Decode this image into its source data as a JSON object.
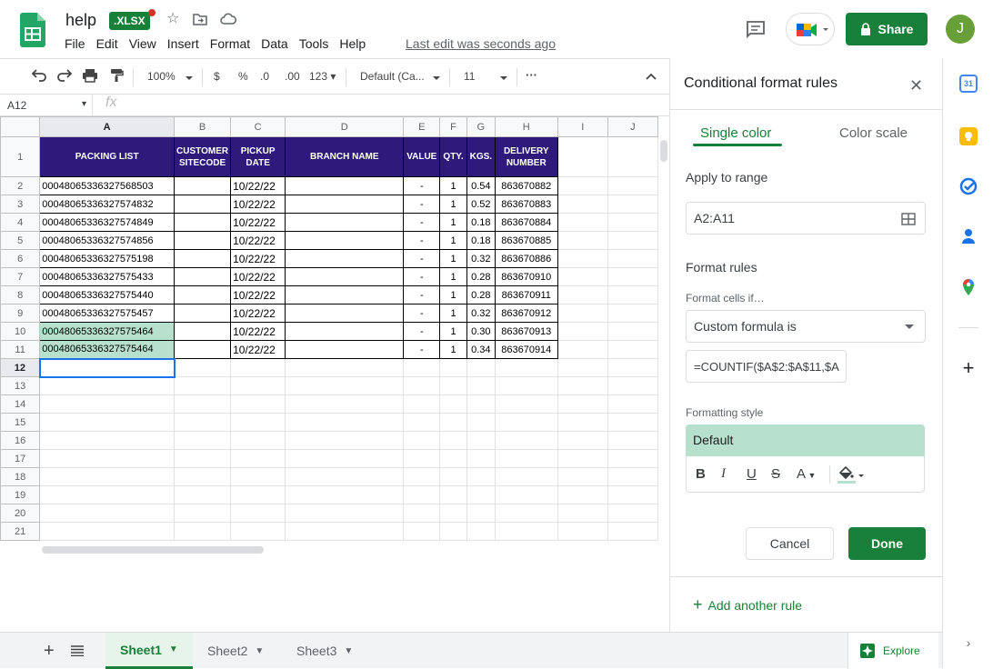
{
  "header": {
    "doc_title": "help",
    "badge": ".XLSX",
    "menu": [
      "File",
      "Edit",
      "View",
      "Insert",
      "Format",
      "Data",
      "Tools",
      "Help"
    ],
    "last_edit": "Last edit was seconds ago",
    "share_label": "Share",
    "avatar_initial": "J"
  },
  "toolbar": {
    "zoom": "100%",
    "currency": "$",
    "percent": "%",
    "dec_less": ".0",
    "dec_more": ".00",
    "more_formats": "123",
    "font": "Default (Ca...",
    "font_size": "11",
    "more": "···"
  },
  "formula_bar": {
    "name_box": "A12",
    "fx": "fx"
  },
  "grid": {
    "columns": [
      "A",
      "B",
      "C",
      "D",
      "E",
      "F",
      "G",
      "H",
      "I",
      "J"
    ],
    "header_row": [
      "PACKING LIST",
      "CUSTOMER SITECODE",
      "PICKUP DATE",
      "BRANCH NAME",
      "VALUE",
      "QTY.",
      "KGS.",
      "DELIVERY NUMBER"
    ],
    "rows": [
      [
        "00048065336327568503",
        "",
        "10/22/22",
        "",
        "-",
        "1",
        "0.54",
        "863670882"
      ],
      [
        "00048065336327574832",
        "",
        "10/22/22",
        "",
        "-",
        "1",
        "0.52",
        "863670883"
      ],
      [
        "00048065336327574849",
        "",
        "10/22/22",
        "",
        "-",
        "1",
        "0.18",
        "863670884"
      ],
      [
        "00048065336327574856",
        "",
        "10/22/22",
        "",
        "-",
        "1",
        "0.18",
        "863670885"
      ],
      [
        "00048065336327575198",
        "",
        "10/22/22",
        "",
        "-",
        "1",
        "0.32",
        "863670886"
      ],
      [
        "00048065336327575433",
        "",
        "10/22/22",
        "",
        "-",
        "1",
        "0.28",
        "863670910"
      ],
      [
        "00048065336327575440",
        "",
        "10/22/22",
        "",
        "-",
        "1",
        "0.28",
        "863670911"
      ],
      [
        "00048065336327575457",
        "",
        "10/22/22",
        "",
        "-",
        "1",
        "0.32",
        "863670912"
      ],
      [
        "00048065336327575464",
        "",
        "10/22/22",
        "",
        "-",
        "1",
        "0.30",
        "863670913"
      ],
      [
        "00048065336327575464",
        "",
        "10/22/22",
        "",
        "-",
        "1",
        "0.34",
        "863670914"
      ]
    ],
    "empty_row_numbers": [
      "12",
      "13",
      "14",
      "15",
      "16",
      "17",
      "18",
      "19",
      "20",
      "21"
    ],
    "highlight_color": "#b7e1cd",
    "header_color": "#2e1a7a"
  },
  "sheets": {
    "tabs": [
      "Sheet1",
      "Sheet2",
      "Sheet3"
    ],
    "active": "Sheet1",
    "explore_label": "Explore"
  },
  "panel": {
    "title": "Conditional format rules",
    "tab_single": "Single color",
    "tab_scale": "Color scale",
    "apply_label": "Apply to range",
    "range": "A2:A11",
    "rules_label": "Format rules",
    "cells_if_label": "Format cells if…",
    "condition": "Custom formula is",
    "formula": "=COUNTIF($A$2:$A$11,$A",
    "style_label": "Formatting style",
    "style_preview": "Default",
    "cancel_label": "Cancel",
    "done_label": "Done",
    "add_rule_label": "Add another rule"
  },
  "colors": {
    "accent": "#188038"
  }
}
